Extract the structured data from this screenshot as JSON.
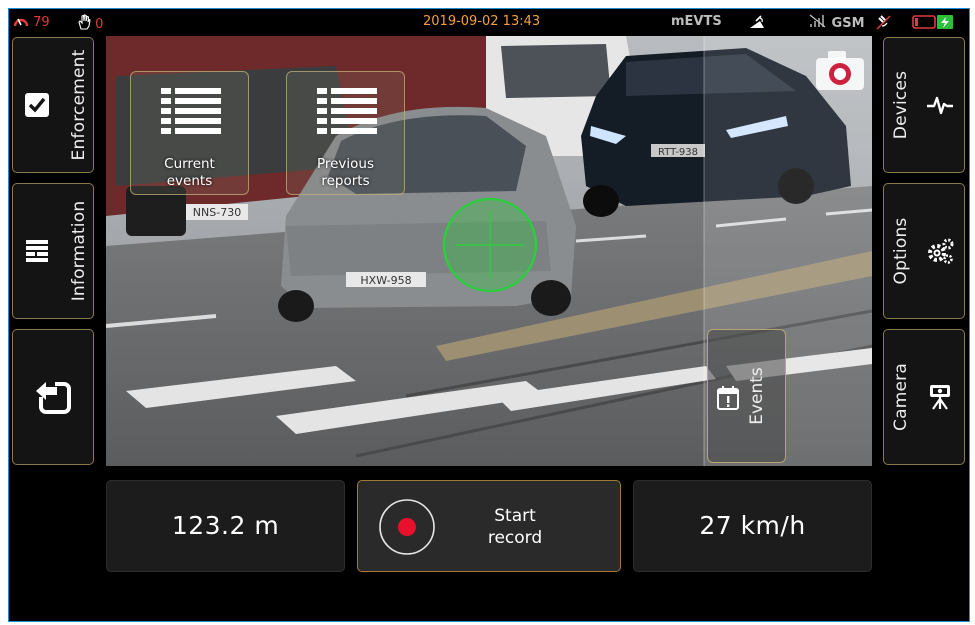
{
  "status": {
    "signal_value": "79",
    "hand_count": "0",
    "datetime": "2019-09-02 13:43",
    "mode": "mEVTS",
    "network": "GSM"
  },
  "left_panel": {
    "enforcement_label": "Enforcement",
    "information_label": "Information"
  },
  "right_panel": {
    "devices_label": "Devices",
    "options_label": "Options",
    "camera_label": "Camera"
  },
  "camera_view": {
    "tiles": [
      {
        "line1": "Current",
        "line2": "events"
      },
      {
        "line1": "Previous",
        "line2": "reports"
      }
    ],
    "events_label": "Events",
    "plates": [
      "NNS-730",
      "HXW-958",
      "RTT-938"
    ]
  },
  "bottom": {
    "distance": "123.2 m",
    "record_line1": "Start",
    "record_line2": "record",
    "speed": "27 km/h"
  },
  "icons": {
    "signal": "speedometer-icon",
    "hand": "hand-icon",
    "enforcement": "checkbox-icon",
    "information": "info-list-icon",
    "back": "back-arrow-icon",
    "devices": "pulse-icon",
    "options": "gears-icon",
    "camera": "camera-tripod-icon",
    "snapshot": "camera-icon",
    "events": "calendar-alert-icon",
    "record": "record-icon"
  },
  "colors": {
    "accent_orange": "#f2a13c",
    "frame_border": "#1f8fd1",
    "record_red": "#e8102a",
    "target_green": "#2ecc40",
    "battery_red": "#e23b3b",
    "battery_green": "#2bbf3a"
  }
}
